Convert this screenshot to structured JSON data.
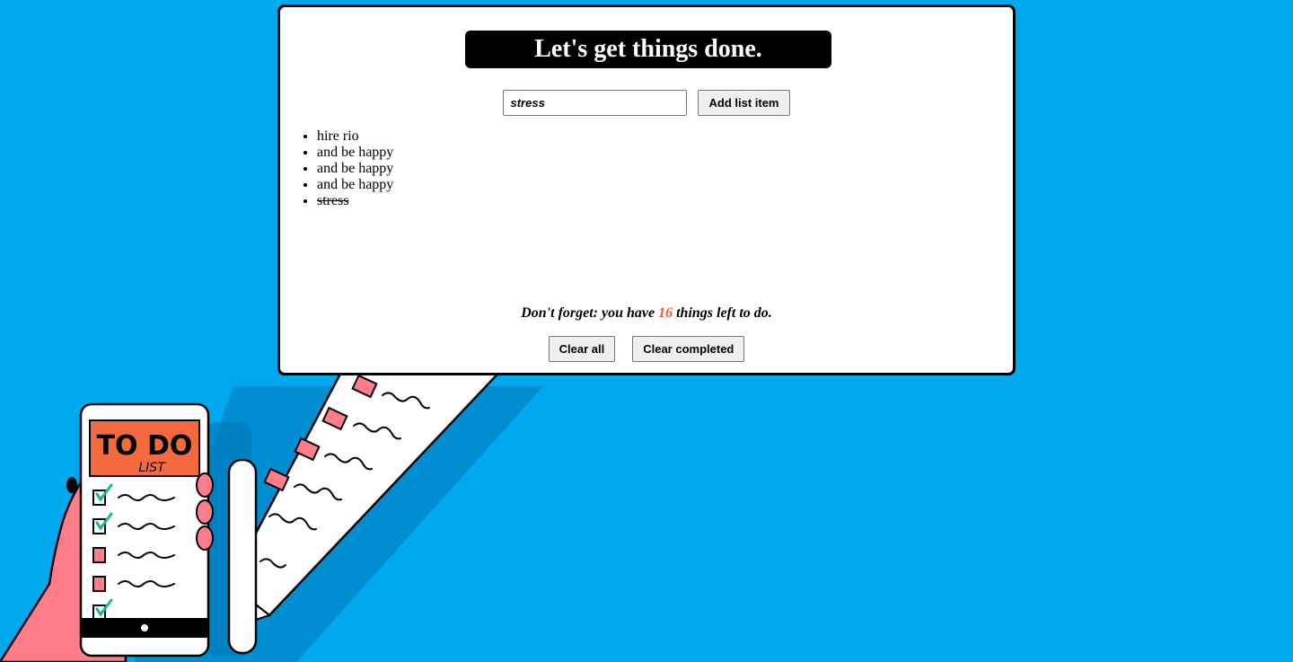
{
  "app": {
    "title": "Let's get things done."
  },
  "add_form": {
    "input_value": "stress",
    "add_button_label": "Add list item"
  },
  "todo_items": [
    {
      "text": "hire rio",
      "completed": false
    },
    {
      "text": "and be happy",
      "completed": false
    },
    {
      "text": "and be happy",
      "completed": false
    },
    {
      "text": "and be happy",
      "completed": false
    },
    {
      "text": "stress",
      "completed": true
    }
  ],
  "reminder": {
    "prefix": "Don't forget: you have",
    "count": "16",
    "suffix": "things left to do."
  },
  "actions": {
    "clear_all_label": "Clear all",
    "clear_completed_label": "Clear completed"
  },
  "illustration": {
    "phone_title": "TO DO",
    "phone_subtitle": "LIST"
  },
  "colors": {
    "background": "#00a9ee",
    "accent_count": "#ef5a33",
    "hand": "#ff7d8a",
    "phone_header": "#f26a3d",
    "check": "#17b890",
    "checkbox_pink": "#ff7d8a"
  }
}
